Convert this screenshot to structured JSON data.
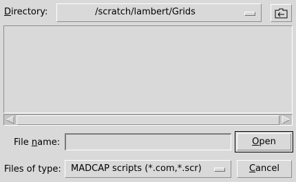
{
  "directory": {
    "label_hotkey": "D",
    "label_rest": "irectory:",
    "path": "/scratch/lambert/Grids",
    "up_icon": "folder-up-icon"
  },
  "file_list": {
    "items": []
  },
  "file_name": {
    "label_pre": "File ",
    "label_hotkey": "n",
    "label_post": "ame:",
    "value": ""
  },
  "file_type": {
    "label": "Files of type:",
    "selected": "MADCAP scripts (*.com,*.scr)"
  },
  "buttons": {
    "open_hotkey": "O",
    "open_rest": "pen",
    "cancel_hotkey": "C",
    "cancel_rest": "ancel"
  }
}
